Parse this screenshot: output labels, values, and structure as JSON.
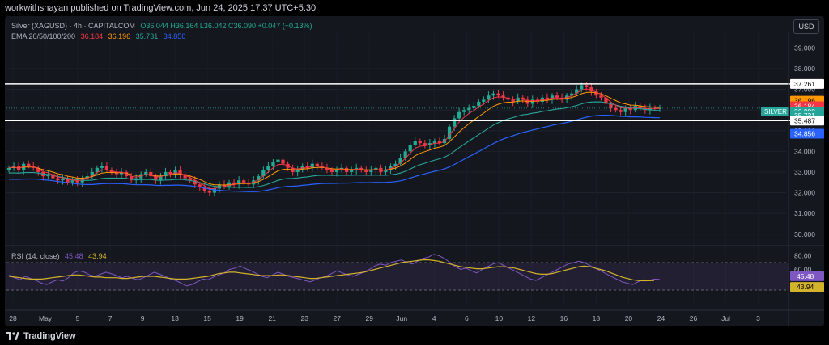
{
  "header": {
    "published_text": "workwithshayan published on TradingView.com, Jun 24, 2025 17:37 UTC+5:30"
  },
  "legend": {
    "symbol_line": "Silver (XAGUSD) · 4h · CAPITALCOM",
    "ohlc": "O36.044 H36.164 L36.042 C36.090 +0.047 (+0.13%)",
    "ema_label": "EMA 20/50/100/200",
    "ema20": "36.184",
    "ema50": "36.196",
    "ema100": "35.731",
    "ema200": "34.856"
  },
  "currency_button": "USD",
  "rsi_legend": {
    "label": "RSI (14, close)",
    "rsi": "45.48",
    "rsi_ma": "43.94"
  },
  "footer": {
    "brand": "TradingView"
  },
  "colors": {
    "up": "#22ab94",
    "down": "#f23645",
    "ema20": "#f23645",
    "ema50": "#ff9800",
    "ema100": "#26a69a",
    "ema200": "#2962ff",
    "rsi": "#7e57c2",
    "rsi_ma": "#d4b32c",
    "resistance": "#ffffff"
  },
  "chart_data": {
    "type": "candlestick",
    "price_axis_ticks": [
      "39.000",
      "38.000",
      "37.000",
      "36.000",
      "35.000",
      "34.000",
      "33.000",
      "32.000",
      "31.000",
      "30.000"
    ],
    "price_range": [
      29.6,
      39.6
    ],
    "rsi_axis_ticks": [
      "80.00",
      "60.00"
    ],
    "rsi_range": [
      10,
      90
    ],
    "rsi_band": [
      30,
      70
    ],
    "time_axis_ticks": [
      "28",
      "May",
      "5",
      "7",
      "9",
      "13",
      "15",
      "19",
      "21",
      "23",
      "27",
      "29",
      "Jun",
      "4",
      "6",
      "10",
      "12",
      "16",
      "18",
      "20",
      "24",
      "26",
      "Jul",
      "3"
    ],
    "levels": [
      {
        "name": "resistance",
        "value": 37.261,
        "label": "37.261"
      },
      {
        "name": "support",
        "value": 35.487,
        "label": "35.487"
      }
    ],
    "price_labels": [
      {
        "label": "37.261",
        "value": 37.261,
        "bg": "#ffffff",
        "fg": "#000000"
      },
      {
        "label": "36.196",
        "value": 36.45,
        "bg": "#ff9800",
        "fg": "#000000"
      },
      {
        "label": "36.184",
        "value": 36.184,
        "bg": "#f23645",
        "fg": "#ffffff"
      },
      {
        "label": "36.090",
        "value": 35.93,
        "bg": "#26a69a",
        "fg": "#ffffff",
        "tag": "SILVER"
      },
      {
        "label": "35.731",
        "value": 35.731,
        "bg": "#26a69a",
        "fg": "#ffffff"
      },
      {
        "label": "35.487",
        "value": 35.487,
        "bg": "#ffffff",
        "fg": "#000000"
      },
      {
        "label": "34.856",
        "value": 34.856,
        "bg": "#2962ff",
        "fg": "#ffffff"
      }
    ],
    "rsi_labels": [
      {
        "label": "45.48",
        "value": 45.48,
        "bg": "#7e57c2",
        "fg": "#ffffff"
      },
      {
        "label": "43.94",
        "value": 43.94,
        "bg": "#d4b32c",
        "fg": "#000000"
      }
    ],
    "close_series": [
      33.2,
      33.3,
      33.1,
      33.4,
      33.3,
      33.2,
      33.0,
      32.8,
      32.9,
      32.7,
      32.6,
      32.7,
      32.5,
      32.6,
      32.5,
      32.7,
      32.8,
      33.0,
      33.2,
      33.3,
      33.1,
      33.0,
      32.9,
      33.0,
      32.8,
      32.6,
      32.7,
      32.9,
      33.0,
      32.8,
      32.6,
      32.8,
      33.0,
      32.9,
      33.1,
      32.9,
      32.7,
      32.6,
      32.4,
      32.3,
      32.1,
      32.0,
      32.2,
      32.4,
      32.3,
      32.5,
      32.4,
      32.6,
      32.5,
      32.4,
      32.6,
      32.8,
      33.1,
      33.3,
      33.5,
      33.6,
      33.4,
      33.2,
      33.0,
      33.1,
      33.3,
      33.2,
      33.4,
      33.3,
      33.2,
      33.1,
      33.0,
      33.1,
      33.2,
      33.0,
      33.1,
      33.2,
      33.1,
      33.0,
      33.1,
      33.2,
      33.0,
      33.1,
      33.3,
      33.4,
      33.7,
      34.0,
      34.3,
      34.5,
      34.4,
      34.3,
      34.4,
      34.5,
      34.4,
      34.6,
      35.2,
      35.6,
      35.9,
      36.0,
      36.1,
      36.2,
      36.4,
      36.5,
      36.7,
      36.8,
      36.7,
      36.6,
      36.5,
      36.4,
      36.6,
      36.5,
      36.3,
      36.5,
      36.4,
      36.6,
      36.5,
      36.7,
      36.6,
      36.5,
      36.7,
      36.8,
      37.0,
      37.2,
      37.1,
      36.9,
      36.7,
      36.6,
      36.3,
      36.1,
      36.0,
      35.9,
      36.1,
      36.0,
      36.2,
      36.1,
      36.0,
      36.1,
      36.05,
      36.09
    ],
    "rsi_series": [
      52,
      48,
      45,
      50,
      47,
      44,
      40,
      38,
      42,
      45,
      43,
      48,
      55,
      58,
      56,
      52,
      50,
      53,
      56,
      54,
      51,
      48,
      50,
      47,
      45,
      48,
      52,
      56,
      53,
      50,
      46,
      44,
      40,
      36,
      38,
      42,
      46,
      45,
      49,
      52,
      55,
      60,
      62,
      65,
      61,
      58,
      54,
      50,
      48,
      52,
      56,
      53,
      50,
      48,
      46,
      44,
      42,
      45,
      48,
      50,
      54,
      58,
      55,
      52,
      50,
      53,
      56,
      60,
      65,
      68,
      66,
      70,
      72,
      74,
      70,
      68,
      72,
      76,
      78,
      82,
      80,
      76,
      70,
      64,
      60,
      62,
      58,
      55,
      60,
      64,
      68,
      70,
      66,
      62,
      58,
      54,
      50,
      46,
      44,
      48,
      52,
      56,
      60,
      64,
      68,
      70,
      72,
      70,
      66,
      62,
      58,
      54,
      50,
      46,
      42,
      40,
      38,
      42,
      45,
      44,
      46,
      45.48
    ],
    "rsi_ma_series": [
      50,
      49,
      48,
      47,
      46,
      46,
      46,
      47,
      48,
      49,
      50,
      51,
      52,
      52,
      51,
      50,
      49,
      49,
      48,
      48,
      48,
      47,
      47,
      48,
      49,
      50,
      50,
      50,
      49,
      48,
      47,
      46,
      46,
      46,
      47,
      48,
      49,
      50,
      52,
      54,
      55,
      56,
      56,
      55,
      54,
      53,
      52,
      51,
      51,
      51,
      52,
      52,
      51,
      50,
      49,
      48,
      47,
      47,
      48,
      49,
      50,
      51,
      52,
      53,
      54,
      55,
      56,
      58,
      60,
      62,
      64,
      66,
      68,
      70,
      71,
      72,
      73,
      74,
      74,
      73,
      72,
      70,
      68,
      66,
      64,
      63,
      62,
      61,
      61,
      62,
      63,
      64,
      64,
      63,
      62,
      60,
      58,
      56,
      54,
      53,
      53,
      54,
      56,
      58,
      60,
      62,
      64,
      65,
      64,
      62,
      60,
      58,
      55,
      52,
      49,
      47,
      45,
      44,
      43.5,
      43.7,
      43.94
    ]
  }
}
